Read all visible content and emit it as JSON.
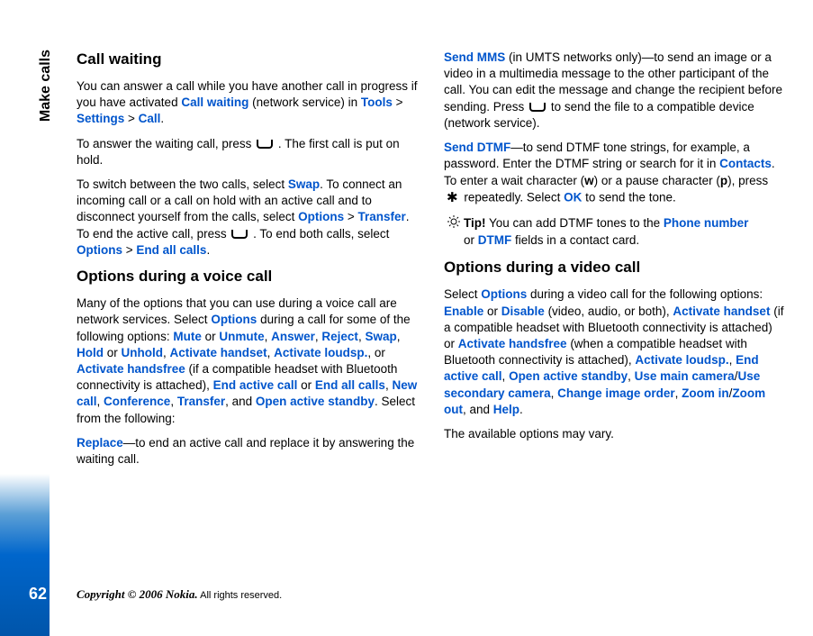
{
  "sidebar": {
    "section_label": "Make calls",
    "page_number": "62"
  },
  "footer": {
    "copyright_strong": "Copyright © 2006 Nokia.",
    "copyright_rest": " All rights reserved."
  },
  "col1": {
    "h1": "Call waiting",
    "p1a": "You can answer a call while you have another call in progress if you have activated ",
    "p1_link1": "Call waiting",
    "p1b": " (network service) in ",
    "p1_link2": "Tools",
    "p1c": " > ",
    "p1_link3": "Settings",
    "p1d": " > ",
    "p1_link4": "Call",
    "p1e": ".",
    "p2a": "To answer the waiting call, press ",
    "p2b": " . The first call is put on hold.",
    "p3a": "To switch between the two calls, select ",
    "p3_link1": "Swap",
    "p3b": ". To connect an incoming call or a call on hold with an active call and to disconnect yourself from the calls, select ",
    "p3_link2": "Options",
    "p3c": " > ",
    "p3_link3": "Transfer",
    "p3d": ". To end the active call, press ",
    "p3e": " . To end both calls, select ",
    "p3_link4": "Options",
    "p3f": " > ",
    "p3_link5": "End all calls",
    "p3g": ".",
    "h2": "Options during a voice call",
    "p4a": "Many of the options that you can use during a voice call are network services. Select ",
    "p4_link1": "Options",
    "p4b": " during a call for some of the following options: ",
    "p4_link2": "Mute",
    "p4c": " or ",
    "p4_link3": "Unmute",
    "p4d": ", ",
    "p4_link4": "Answer",
    "p4e": ", ",
    "p4_link5": "Reject",
    "p4f": ", ",
    "p4_link6": "Swap",
    "p4g": ", ",
    "p4_link7": "Hold",
    "p4h": " or ",
    "p4_link8": "Unhold",
    "p4i": ", ",
    "p4_link9": "Activate handset",
    "p4j": ", ",
    "p4_link10": "Activate loudsp.",
    "p4k": ", or ",
    "p4_link11": "Activate handsfree",
    "p4l": " (if a compatible headset with Bluetooth connectivity is attached), ",
    "p4_link12": "End active call",
    "p4m": " or ",
    "p4_link13": "End all calls",
    "p4n": ", ",
    "p4_link14": "New call",
    "p4o": ", ",
    "p4_link15": "Conference",
    "p4p": ", ",
    "p4_link16": "Transfer",
    "p4q": ", and ",
    "p4_link17": "Open active standby",
    "p4r": ". Select from the following:",
    "p5_link1": "Replace",
    "p5a": "—to end an active call and replace it by answering the waiting call."
  },
  "col2": {
    "p1_link1": "Send MMS",
    "p1a": " (in UMTS networks only)—to send an image or a video in a multimedia message to the other participant of the call. You can edit the message and change the recipient before sending. Press ",
    "p1b": " to send the file to a compatible device (network service).",
    "p2_link1": "Send DTMF",
    "p2a": "—to send DTMF tone strings, for example, a password. Enter the DTMF string or search for it in ",
    "p2_link2": "Contacts",
    "p2b": ". To enter a wait character (",
    "p2_bold1": "w",
    "p2c": ") or a pause character (",
    "p2_bold2": "p",
    "p2d": "), press ",
    "p2e": " repeatedly. Select ",
    "p2_link3": "OK",
    "p2f": " to send the tone.",
    "tip_label": "Tip!",
    "tip_a": " You can add DTMF tones to the ",
    "tip_link1": "Phone number",
    "tip_b": " or ",
    "tip_link2": "DTMF",
    "tip_c": " fields in a contact card.",
    "h1": "Options during a video call",
    "p3a": "Select ",
    "p3_link1": "Options",
    "p3b": " during a video call for the following options: ",
    "p3_link2": "Enable",
    "p3c": " or ",
    "p3_link3": "Disable",
    "p3d": " (video, audio, or both), ",
    "p3_link4": "Activate handset",
    "p3e": " (if a compatible headset with Bluetooth connectivity is attached) or ",
    "p3_link5": "Activate handsfree",
    "p3f": " (when a compatible headset with Bluetooth connectivity is attached), ",
    "p3_link6": "Activate loudsp.",
    "p3g": ", ",
    "p3_link7": "End active call",
    "p3h": ", ",
    "p3_link8": "Open active standby",
    "p3i": ", ",
    "p3_link9": "Use main camera",
    "p3j": "/",
    "p3_link10": "Use secondary camera",
    "p3k": ", ",
    "p3_link11": "Change image order",
    "p3l": ", ",
    "p3_link12": "Zoom in",
    "p3m": "/",
    "p3_link13": "Zoom out",
    "p3n": ", and ",
    "p3_link14": "Help",
    "p3o": ".",
    "p4": "The available options may vary."
  }
}
